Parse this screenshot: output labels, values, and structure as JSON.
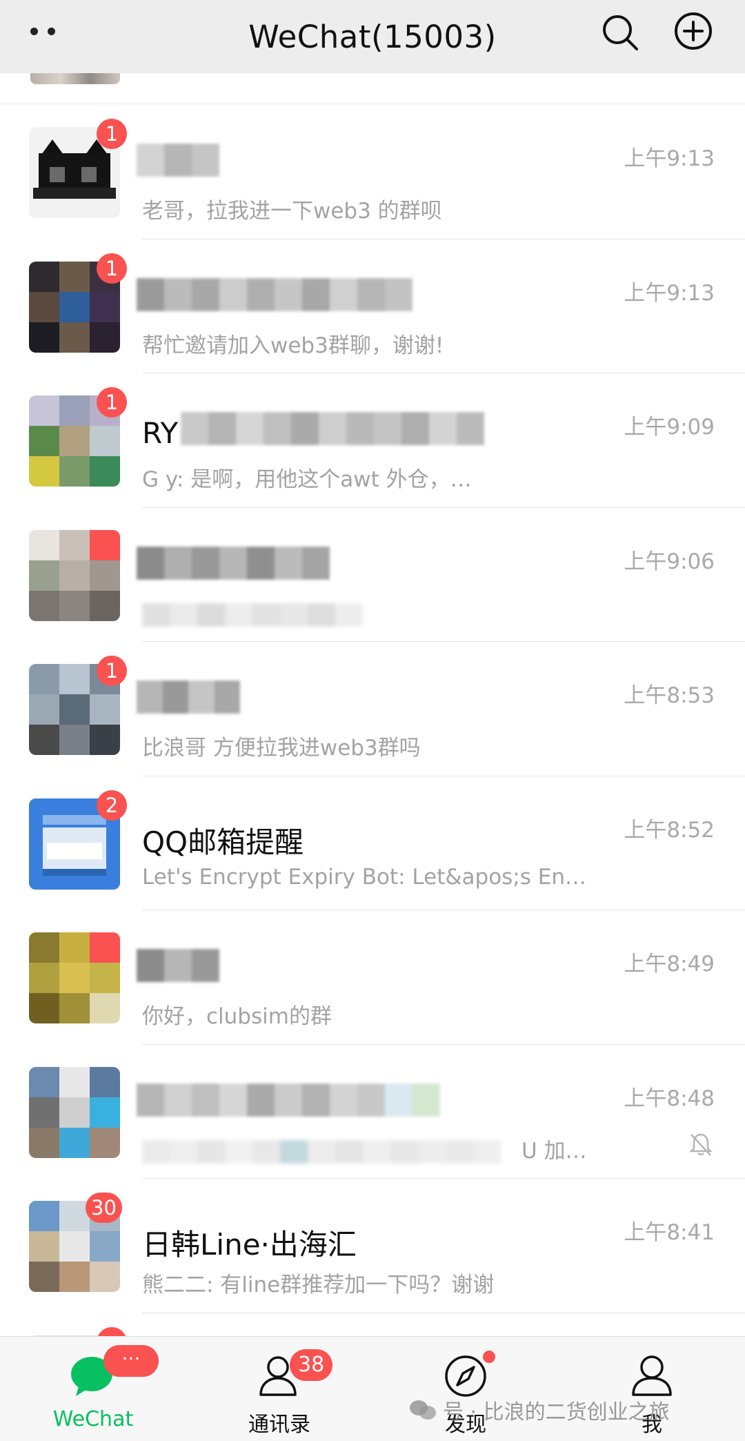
{
  "header": {
    "title": "WeChat(15003)"
  },
  "chats": [
    {
      "name": "",
      "message": "老哥，拉我进一下web3 的群呗",
      "time": "上午9:13",
      "badge": "1",
      "muted": false
    },
    {
      "name": "",
      "message": "帮忙邀请加入web3群聊，谢谢!",
      "time": "上午9:13",
      "badge": "1",
      "muted": false
    },
    {
      "name": "RY",
      "message": "G y: 是啊，用他这个awt   外仓，…",
      "time": "上午9:09",
      "badge": "1",
      "muted": false
    },
    {
      "name": "",
      "message": "",
      "time": "上午9:06",
      "badge": "",
      "muted": false
    },
    {
      "name": "",
      "message": "比浪哥 方便拉我进web3群吗",
      "time": "上午8:53",
      "badge": "1",
      "muted": false
    },
    {
      "name": "QQ邮箱提醒",
      "message": "Let's Encrypt Expiry Bot: Let&apos;s En…",
      "time": "上午8:52",
      "badge": "2",
      "muted": false
    },
    {
      "name": "",
      "message": "你好，clubsim的群",
      "time": "上午8:49",
      "badge": "",
      "muted": false
    },
    {
      "name": "",
      "message": "U 加…",
      "time": "上午8:48",
      "badge": "",
      "muted": true
    },
    {
      "name": "日韩Line·出海汇",
      "message": "熊二二: 有line群推荐加一下吗？谢谢",
      "time": "上午8:41",
      "badge": "30",
      "muted": false
    }
  ],
  "tabs": [
    {
      "label": "WeChat",
      "badge": "···",
      "icon": "chat-bubble-icon"
    },
    {
      "label": "通讯录",
      "badge": "38",
      "icon": "contacts-icon"
    },
    {
      "label": "发现",
      "badge": "",
      "icon": "compass-icon"
    },
    {
      "label": "我",
      "badge": "",
      "icon": "person-icon"
    }
  ],
  "watermark": "号 · 比浪的二货创业之旅",
  "colors": {
    "accent": "#07c160",
    "badge": "#fa5151",
    "header_bg": "#ededed"
  }
}
